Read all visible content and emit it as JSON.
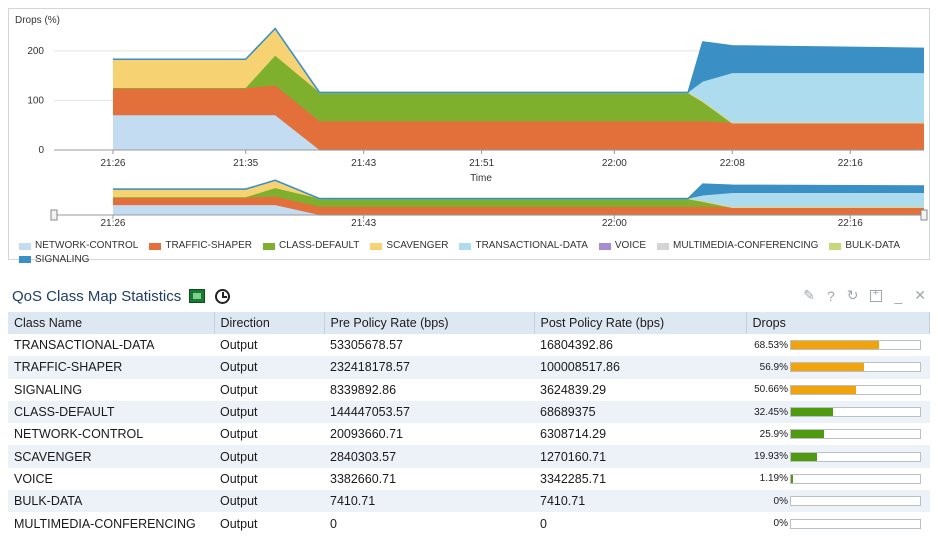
{
  "chart": {
    "y_title": "Drops (%)",
    "x_title": "Time",
    "y_ticks": [
      "200",
      "100",
      "0"
    ],
    "x_ticks": [
      "21:26",
      "21:35",
      "21:43",
      "21:51",
      "22:00",
      "22:08",
      "22:16"
    ],
    "nav_ticks": [
      "21:26",
      "21:43",
      "22:00",
      "22:16"
    ],
    "colors": {
      "network_control": "#c3dcf2",
      "traffic_shaper": "#e3703b",
      "class_default": "#7eb02e",
      "scavenger": "#f6d273",
      "transactional_data": "#aedcef",
      "signaling": "#3a8fc4"
    }
  },
  "chart_data": {
    "type": "area",
    "x": [
      "21:26",
      "21:35",
      "21:37",
      "21:40",
      "21:43",
      "22:05",
      "22:06",
      "22:08",
      "22:21"
    ],
    "ylim": [
      0,
      240
    ],
    "series": [
      {
        "name": "NETWORK-CONTROL",
        "values": [
          70,
          70,
          70,
          0,
          0,
          0,
          0,
          0,
          0
        ]
      },
      {
        "name": "TRAFFIC-SHAPER",
        "values": [
          55,
          55,
          60,
          58,
          58,
          58,
          58,
          55,
          55
        ]
      },
      {
        "name": "CLASS-DEFAULT",
        "values": [
          0,
          0,
          60,
          58,
          58,
          58,
          40,
          0,
          0
        ]
      },
      {
        "name": "SCAVENGER",
        "values": [
          58,
          58,
          55,
          0,
          0,
          0,
          0,
          0,
          0
        ]
      },
      {
        "name": "TRANSACTIONAL-DATA",
        "values": [
          0,
          0,
          0,
          0,
          0,
          0,
          40,
          100,
          100
        ]
      },
      {
        "name": "SIGNALING",
        "values": [
          0,
          0,
          0,
          0,
          0,
          0,
          80,
          55,
          50
        ]
      }
    ]
  },
  "legend": [
    {
      "label": "NETWORK-CONTROL",
      "color": "#c3dcf2"
    },
    {
      "label": "TRAFFIC-SHAPER",
      "color": "#e3703b"
    },
    {
      "label": "CLASS-DEFAULT",
      "color": "#7eb02e"
    },
    {
      "label": "SCAVENGER",
      "color": "#f6d273"
    },
    {
      "label": "TRANSACTIONAL-DATA",
      "color": "#aedcef"
    },
    {
      "label": "VOICE",
      "color": "#a68ed0"
    },
    {
      "label": "MULTIMEDIA-CONFERENCING",
      "color": "#d4d4d4"
    },
    {
      "label": "BULK-DATA",
      "color": "#c5d97a"
    },
    {
      "label": "SIGNALING",
      "color": "#3a8fc4"
    }
  ],
  "stats": {
    "title": "QoS Class Map Statistics",
    "icons": [
      "csv-export-icon",
      "clock-icon",
      "pencil-icon",
      "help-icon",
      "refresh-icon",
      "maximize-icon",
      "minimize-icon",
      "close-icon"
    ],
    "headers": {
      "name": "Class Name",
      "direction": "Direction",
      "pre": "Pre Policy Rate (bps)",
      "post": "Post Policy Rate (bps)",
      "drops": "Drops"
    },
    "rows": [
      {
        "name": "TRANSACTIONAL-DATA",
        "direction": "Output",
        "pre": "53305678.57",
        "post": "16804392.86",
        "drops": "68.53%",
        "pct": 68.53,
        "color": "#f0a30a"
      },
      {
        "name": "TRAFFIC-SHAPER",
        "direction": "Output",
        "pre": "232418178.57",
        "post": "100008517.86",
        "drops": "56.9%",
        "pct": 56.9,
        "color": "#f0a30a"
      },
      {
        "name": "SIGNALING",
        "direction": "Output",
        "pre": "8339892.86",
        "post": "3624839.29",
        "drops": "50.66%",
        "pct": 50.66,
        "color": "#f0a30a"
      },
      {
        "name": "CLASS-DEFAULT",
        "direction": "Output",
        "pre": "144447053.57",
        "post": "68689375",
        "drops": "32.45%",
        "pct": 32.45,
        "color": "#4f9a10"
      },
      {
        "name": "NETWORK-CONTROL",
        "direction": "Output",
        "pre": "20093660.71",
        "post": "6308714.29",
        "drops": "25.9%",
        "pct": 25.9,
        "color": "#4f9a10"
      },
      {
        "name": "SCAVENGER",
        "direction": "Output",
        "pre": "2840303.57",
        "post": "1270160.71",
        "drops": "19.93%",
        "pct": 19.93,
        "color": "#4f9a10"
      },
      {
        "name": "VOICE",
        "direction": "Output",
        "pre": "3382660.71",
        "post": "3342285.71",
        "drops": "1.19%",
        "pct": 1.19,
        "color": "#4f9a10"
      },
      {
        "name": "BULK-DATA",
        "direction": "Output",
        "pre": "7410.71",
        "post": "7410.71",
        "drops": "0%",
        "pct": 0,
        "color": "#4f9a10"
      },
      {
        "name": "MULTIMEDIA-CONFERENCING",
        "direction": "Output",
        "pre": "0",
        "post": "0",
        "drops": "0%",
        "pct": 0,
        "color": "#4f9a10"
      }
    ]
  }
}
